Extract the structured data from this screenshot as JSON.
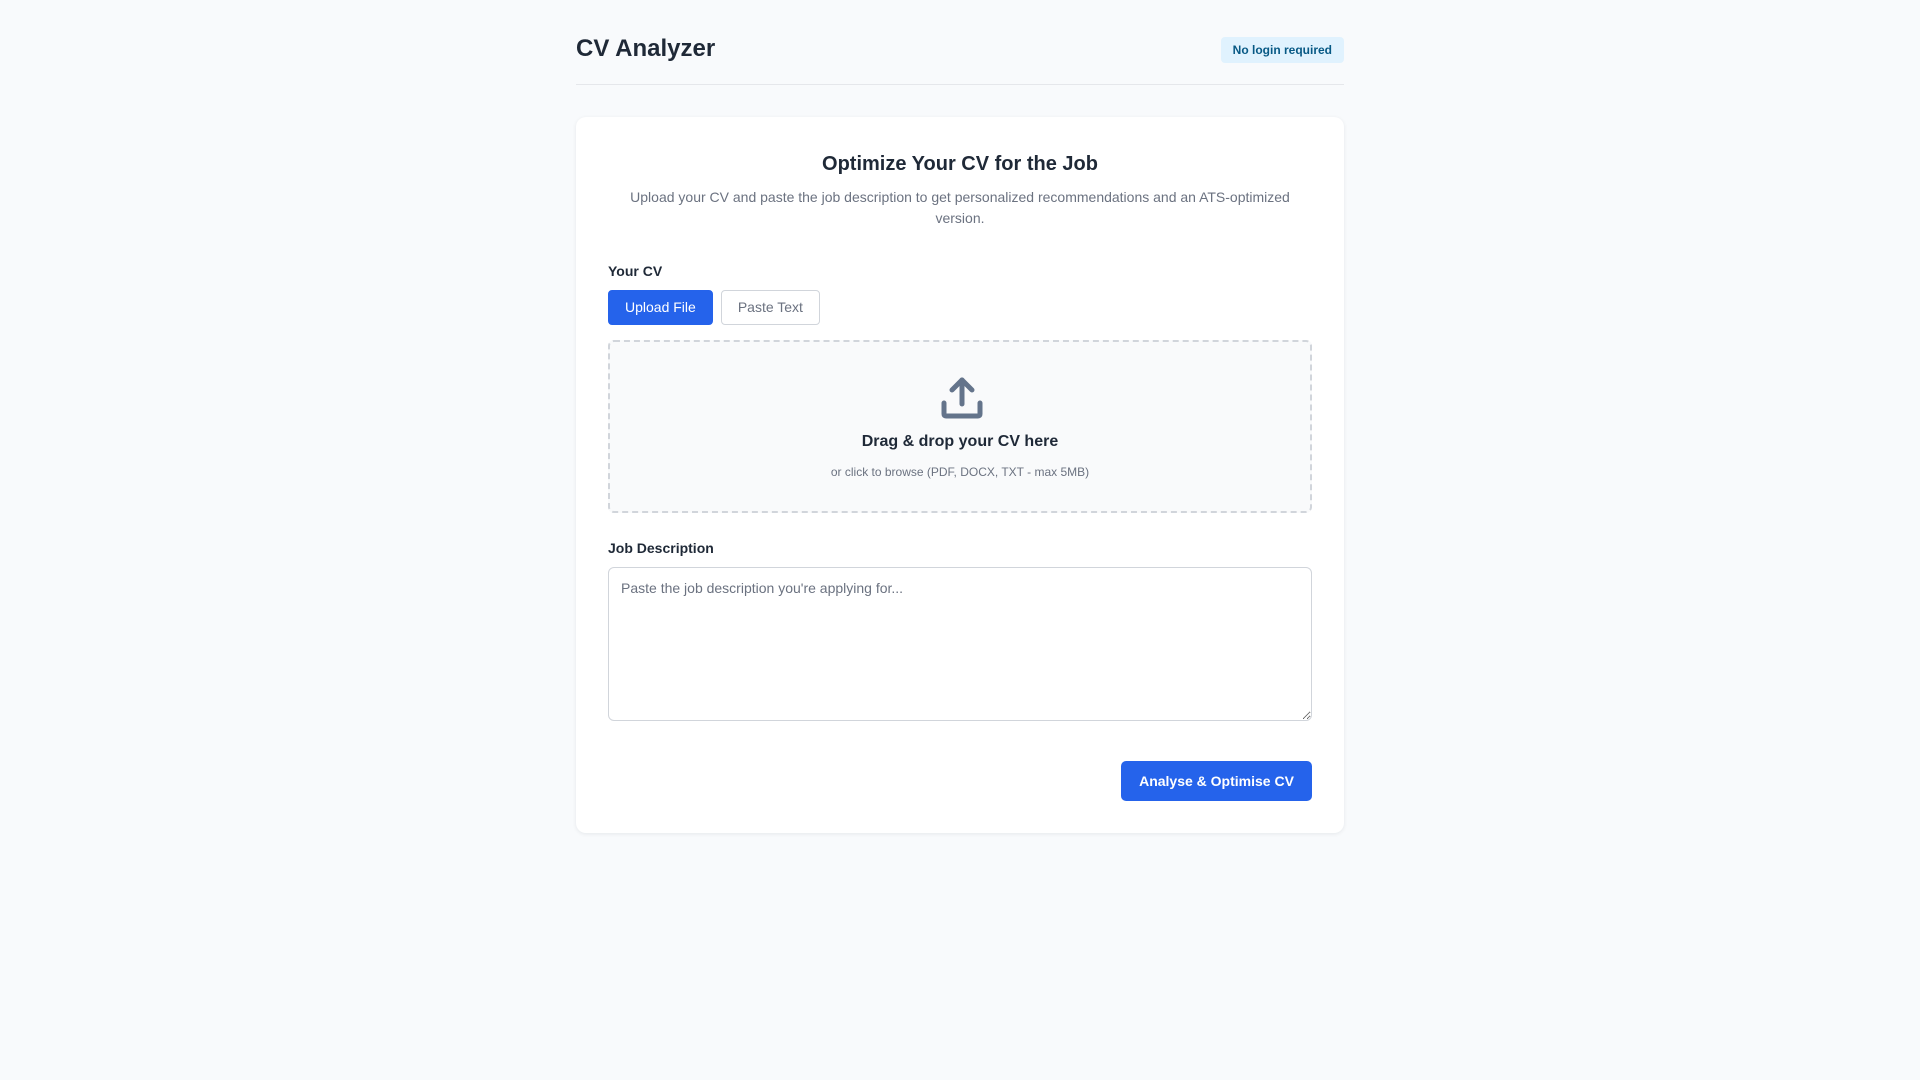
{
  "header": {
    "title": "CV Analyzer",
    "badge": "No login required"
  },
  "card": {
    "title": "Optimize Your CV for the Job",
    "subtitle": "Upload your CV and paste the job description to get personalized recommendations and an ATS-optimized version."
  },
  "cv": {
    "label": "Your CV",
    "tabs": [
      {
        "label": "Upload File",
        "active": true
      },
      {
        "label": "Paste Text",
        "active": false
      }
    ],
    "dropzone": {
      "icon": "upload-icon",
      "title": "Drag & drop your CV here",
      "hint": "or click to browse (PDF, DOCX, TXT - max 5MB)"
    }
  },
  "job": {
    "label": "Job Description",
    "value": "",
    "placeholder": "Paste the job description you're applying for..."
  },
  "actions": {
    "submit_label": "Analyse & Optimise CV"
  },
  "colors": {
    "primary": "#2563eb",
    "background": "#f8fafc",
    "badge_bg": "#e0f2fe",
    "badge_text": "#075985",
    "text": "#1f2937",
    "muted": "#6b7280"
  }
}
